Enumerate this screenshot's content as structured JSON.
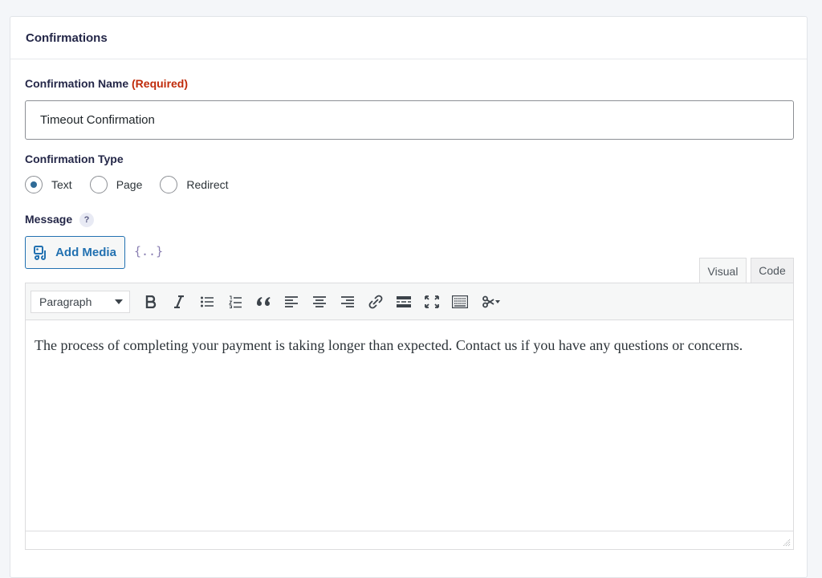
{
  "panel": {
    "title": "Confirmations"
  },
  "name_field": {
    "label": "Confirmation Name",
    "required": "(Required)",
    "value": "Timeout Confirmation"
  },
  "type_field": {
    "label": "Confirmation Type",
    "options": [
      {
        "label": "Text",
        "checked": true
      },
      {
        "label": "Page",
        "checked": false
      },
      {
        "label": "Redirect",
        "checked": false
      }
    ]
  },
  "message": {
    "label": "Message",
    "help": "?",
    "add_media": "Add Media",
    "merge_tag": "{..}",
    "tabs": {
      "visual": "Visual",
      "code": "Code"
    },
    "format": "Paragraph",
    "body": "The process of completing your payment is taking longer than expected. Contact us if you have any questions or concerns."
  },
  "colors": {
    "accent": "#2271b1",
    "required": "#c02b0a",
    "radio_checked": "#2f6b97"
  }
}
